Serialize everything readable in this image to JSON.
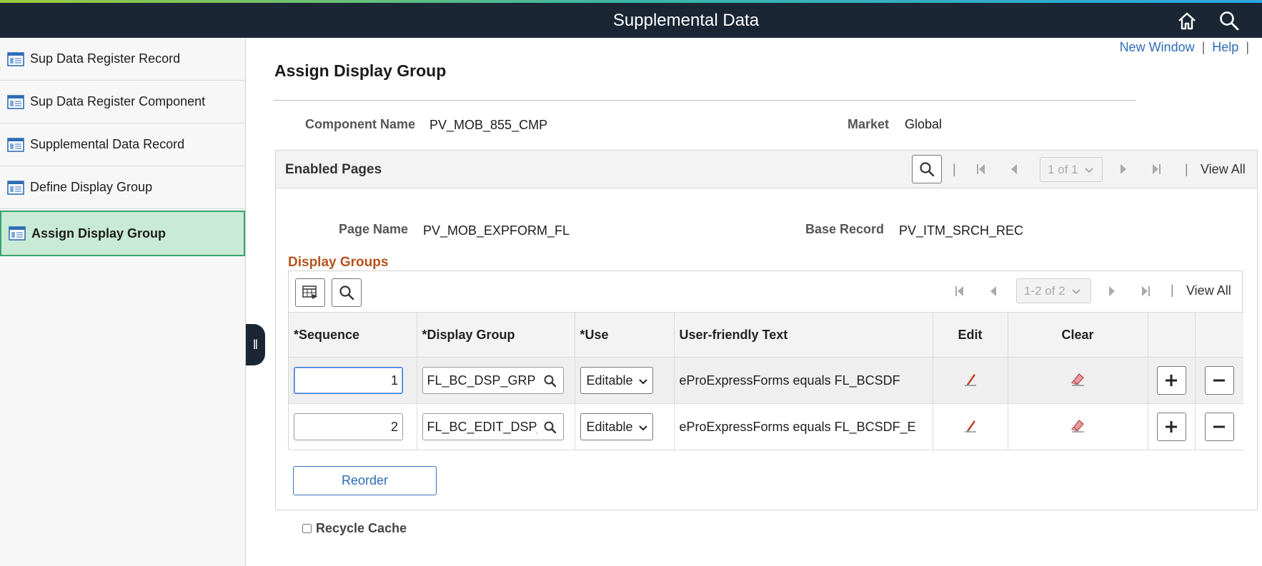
{
  "header": {
    "title": "Supplemental Data",
    "home_icon": "home-icon",
    "search_icon": "search-icon"
  },
  "sidebar": {
    "items": [
      {
        "label": "Sup Data Register Record",
        "active": false
      },
      {
        "label": "Sup Data Register Component",
        "active": false
      },
      {
        "label": "Supplemental Data Record",
        "active": false
      },
      {
        "label": "Define Display Group",
        "active": false
      },
      {
        "label": "Assign Display Group",
        "active": true
      }
    ]
  },
  "links": {
    "new_window": "New Window",
    "help": "Help",
    "sep": "|"
  },
  "page": {
    "title": "Assign Display Group"
  },
  "fields": {
    "component_name_label": "Component Name",
    "component_name": "PV_MOB_855_CMP",
    "market_label": "Market",
    "market": "Global"
  },
  "enabled_pages": {
    "title": "Enabled Pages",
    "pager": "1 of 1",
    "view_all": "View All",
    "page_name_label": "Page Name",
    "page_name": "PV_MOB_EXPFORM_FL",
    "base_record_label": "Base Record",
    "base_record": "PV_ITM_SRCH_REC"
  },
  "display_groups": {
    "title": "Display Groups",
    "pager": "1-2 of 2",
    "view_all": "View All",
    "columns": [
      "*Sequence",
      "*Display Group",
      "*Use",
      "User-friendly Text",
      "Edit",
      "Clear"
    ],
    "rows": [
      {
        "sequence": "1",
        "display_group": "FL_BC_DSP_GRP",
        "use": "Editable",
        "text": "eProExpressForms equals FL_BCSDF"
      },
      {
        "sequence": "2",
        "display_group": "FL_BC_EDIT_DSP_GRP",
        "use": "Editable",
        "text": "eProExpressForms equals FL_BCSDF_E"
      }
    ],
    "reorder_label": "Reorder"
  },
  "recycle_cache_label": "Recycle Cache"
}
